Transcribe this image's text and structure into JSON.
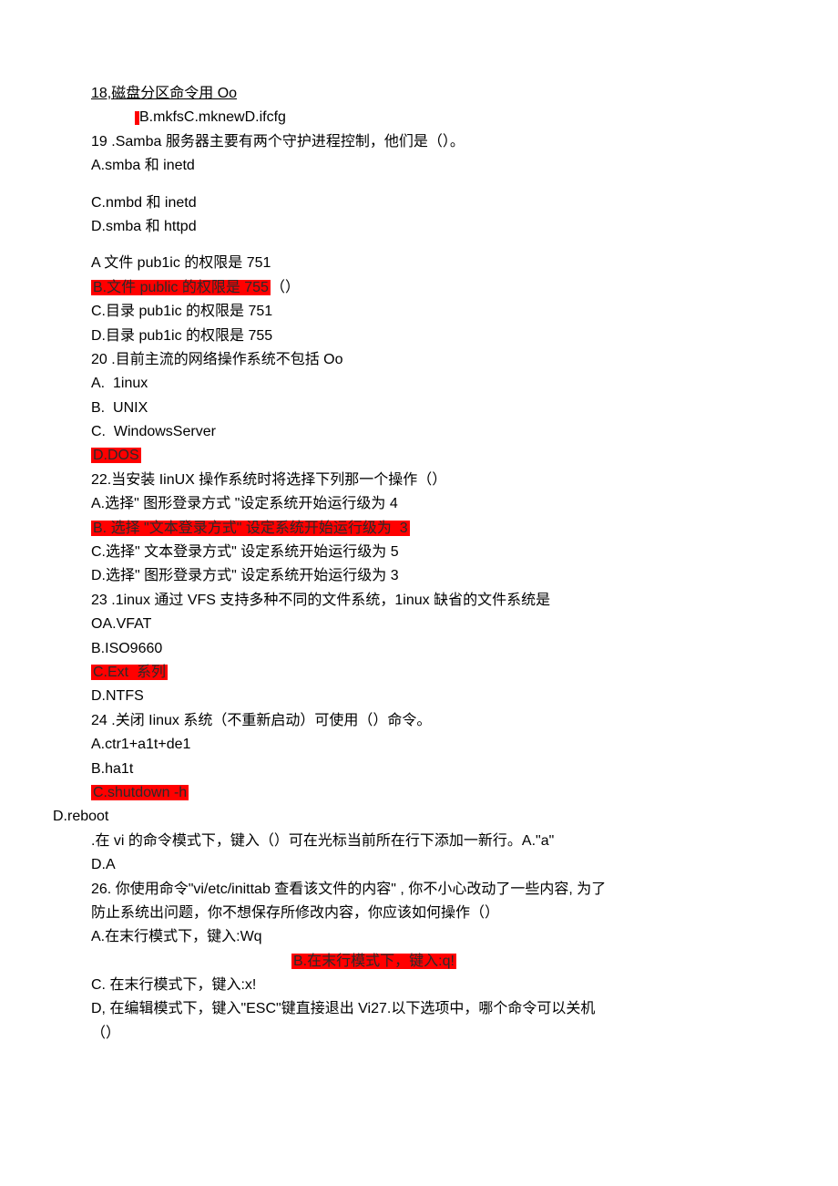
{
  "lines": {
    "l01": "18,磁盘分区命令用 Oo",
    "l02": "B.mkfsC.mknewD.ifcfg",
    "l03": "19 .Samba 服务器主要有两个守护进程控制，他们是（）。",
    "l04": "A.smba 和 inetd",
    "l05": "C.nmbd 和 inetd",
    "l06": "D.smba 和 httpd",
    "l07": "A 文件 pub1ic 的权限是 751",
    "l08": "B.文件 public 的权限是 755",
    "l08b": "（）",
    "l09": "C.目录 pub1ic 的权限是 751",
    "l10": "D.目录 pub1ic 的权限是 755",
    "l11": "20 .目前主流的网络操作系统不包括 Oo",
    "l12": "A.  1inux",
    "l13": "B.  UNIX",
    "l14": "C.  WindowsServer",
    "l15": "D.DOS",
    "l16": "22.当安装 IinUX 操作系统时将选择下列那一个操作（）",
    "l17": "A.选择\" 图形登录方式 \"设定系统开始运行级为 4",
    "l18": "B. 选择 \"文本登录方式\" 设定系统开始运行级为  3",
    "l19": "C.选择\" 文本登录方式\" 设定系统开始运行级为 5",
    "l20": "D.选择\" 图形登录方式\" 设定系统开始运行级为 3",
    "l21": "23 .1inux 通过 VFS 支持多种不同的文件系统，1inux 缺省的文件系统是",
    "l22": "OA.VFAT",
    "l23": "B.ISO9660",
    "l24": "C.Ext  系列",
    "l25": "D.NTFS",
    "l26": "24 .关闭 Iinux 系统（不重新启动）可使用（）命令。",
    "l27": "A.ctr1+a1t+de1",
    "l28": "B.ha1t",
    "l29": "C.shutdown -h",
    "l30": "D.reboot",
    "l31": ".在 vi 的命令模式下，键入（）可在光标当前所在行下添加一新行。A.\"a\"",
    "l32": "D.A",
    "l33": "26. 你使用命令\"vi/etc/inittab 查看该文件的内容\" , 你不小心改动了一些内容, 为了",
    "l34": "防止系统出问题，你不想保存所修改内容，你应该如何操作（）",
    "l35": "A.在末行模式下，键入:Wq",
    "l36": "B.在末行模式下，键入:q!",
    "l37": "C. 在末行模式下，键入:x!",
    "l38": "D, 在编辑模式下，键入\"ESC\"键直接退出 Vi27.以下选项中，哪个命令可以关机",
    "l39": "（）"
  }
}
